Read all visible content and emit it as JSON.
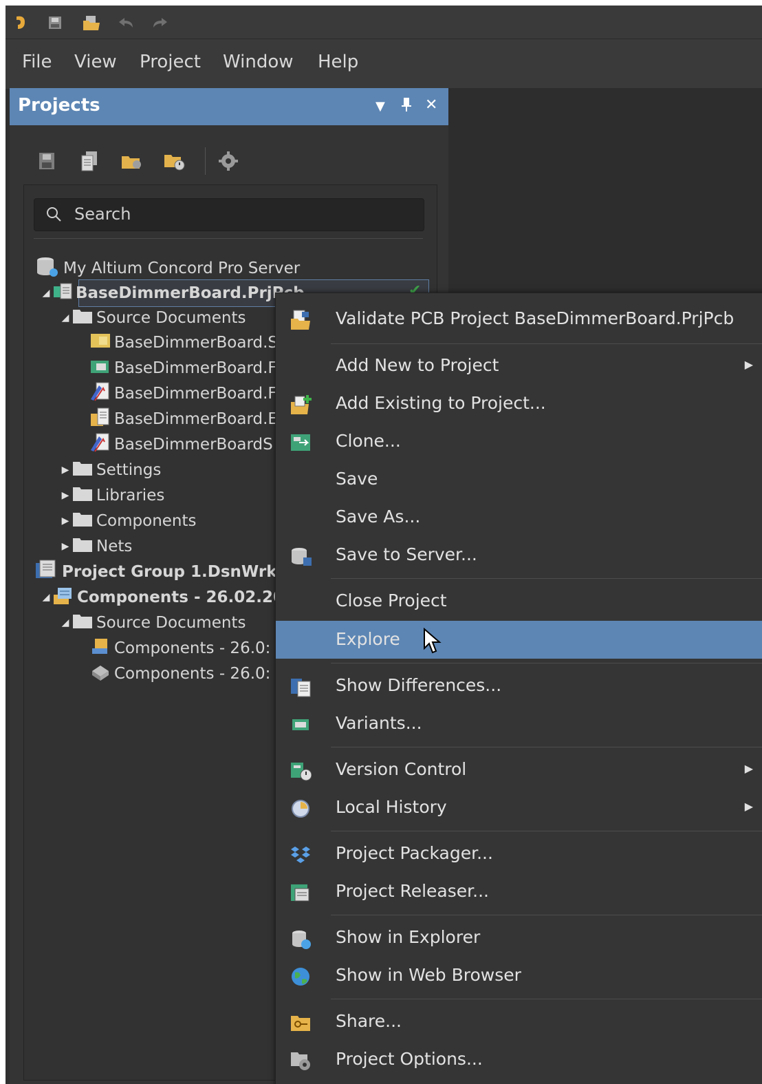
{
  "toolbar": {
    "icons": [
      "app-logo-icon",
      "save-all-icon",
      "open-project-icon",
      "undo-icon",
      "redo-icon"
    ]
  },
  "menubar": {
    "file": "File",
    "view": "View",
    "project": "Project",
    "window": "Window",
    "help": "Help"
  },
  "panel": {
    "title": "Projects",
    "search_placeholder": "Search",
    "header_color": "#5d86b4"
  },
  "tree": {
    "server": "My Altium Concord Pro Server",
    "project": "BaseDimmerBoard.PrjPcb",
    "source_documents": "Source Documents",
    "docs": [
      "BaseDimmerBoard.S",
      "BaseDimmerBoard.F",
      "BaseDimmerBoard.F",
      "BaseDimmerBoard.E",
      "BaseDimmerBoardS"
    ],
    "settings": "Settings",
    "libraries": "Libraries",
    "components": "Components",
    "nets": "Nets",
    "group": "Project Group 1.DsnWrk",
    "group_project": "Components - 26.02.20",
    "group_source": "Source Documents",
    "group_docs": [
      "Components - 26.0:",
      "Components - 26.0:"
    ]
  },
  "context_menu": {
    "validate": "Validate PCB Project BaseDimmerBoard.PrjPcb",
    "add_new": "Add New to Project",
    "add_existing": "Add Existing to Project...",
    "clone": "Clone...",
    "save": "Save",
    "save_as": "Save As...",
    "save_server": "Save to Server...",
    "close": "Close Project",
    "explore": "Explore",
    "show_diff": "Show Differences...",
    "variants": "Variants...",
    "version_control": "Version Control",
    "local_history": "Local History",
    "packager": "Project Packager...",
    "releaser": "Project Releaser...",
    "show_explorer": "Show in Explorer",
    "show_web": "Show in Web Browser",
    "share": "Share...",
    "options": "Project Options..."
  }
}
